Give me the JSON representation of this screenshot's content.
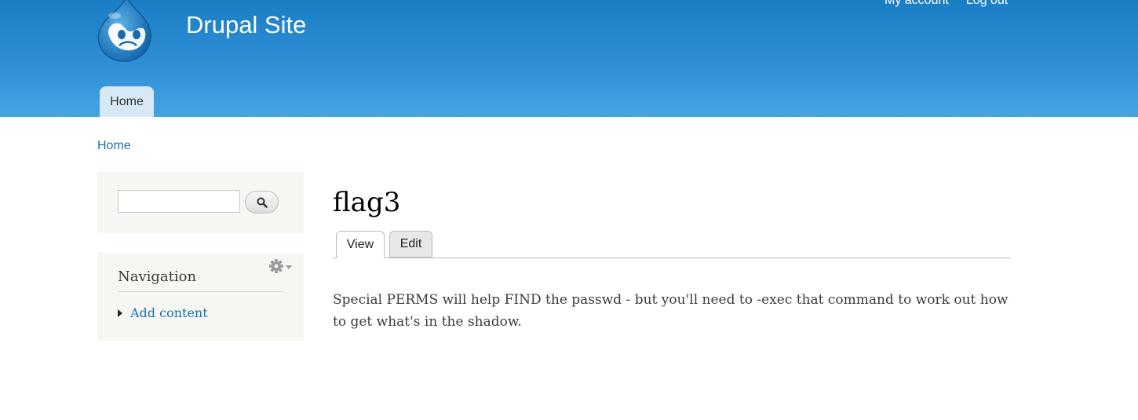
{
  "header": {
    "site_name": "Drupal Site",
    "secondary_menu": [
      "My account",
      "Log out"
    ],
    "main_menu": [
      "Home"
    ]
  },
  "breadcrumb": "Home",
  "sidebar": {
    "search": {
      "placeholder": "",
      "value": "",
      "button_icon": "search-icon"
    },
    "navigation": {
      "title": "Navigation",
      "items": [
        "Add content"
      ]
    }
  },
  "main": {
    "title": "flag3",
    "tabs": [
      "View",
      "Edit"
    ],
    "active_tab": "View",
    "body": "Special PERMS will help FIND the passwd - but you'll need to -exec that command to work out how to get what's in the shadow."
  },
  "colors": {
    "header_top": "#1a7ec5",
    "header_bottom": "#45a5e2",
    "link": "#1b6fb3",
    "sidebar_bg": "#f6f6f2"
  }
}
